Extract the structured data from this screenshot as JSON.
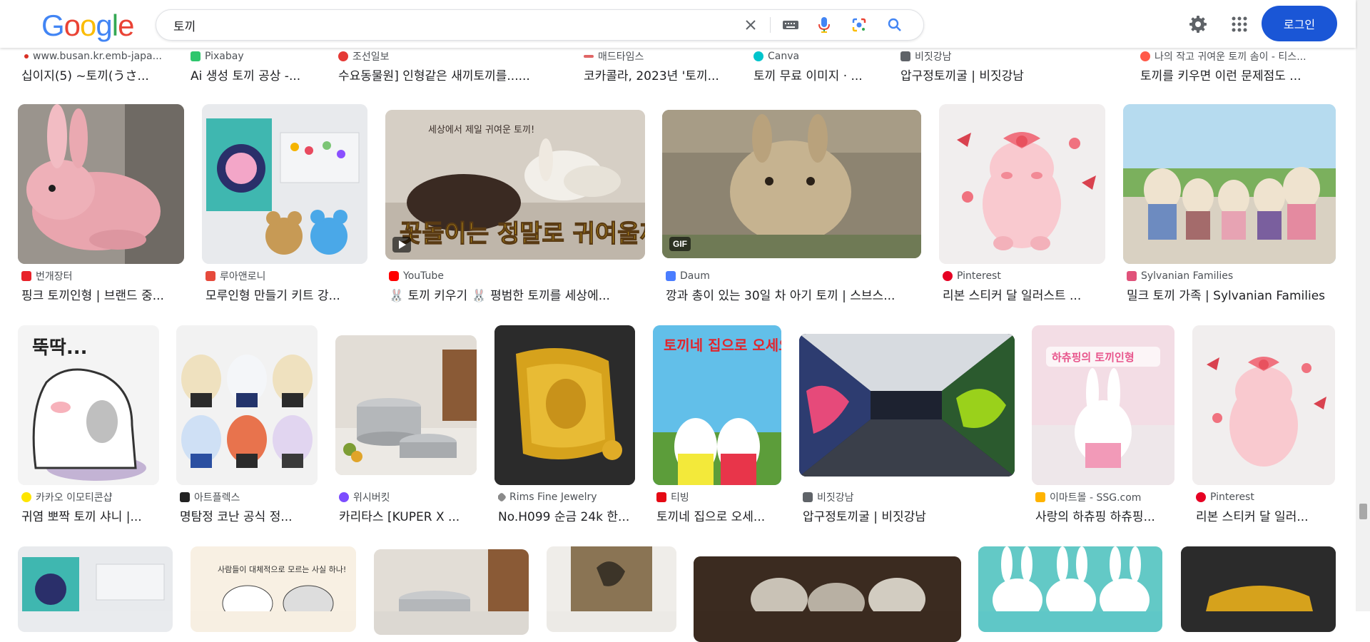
{
  "header": {
    "logo_letters": [
      "G",
      "o",
      "o",
      "g",
      "l",
      "e"
    ],
    "logo_colors": [
      "#4285f4",
      "#ea4335",
      "#fbbc05",
      "#4285f4",
      "#34a853",
      "#ea4335"
    ],
    "search_value": "토끼",
    "login_label": "로그인",
    "icons": {
      "clear": "close-icon",
      "keyboard": "keyboard-icon",
      "voice": "microphone-icon",
      "lens": "lens-icon",
      "search": "search-icon",
      "settings": "gear-icon",
      "apps": "apps-grid-icon"
    },
    "accent": "#1a56d6"
  },
  "rows": [
    {
      "items": [
        {
          "source": "www.busan.kr.emb-japa...",
          "title": "십이지(5) ~토끼(うさ...",
          "fav_color": "#d93025"
        },
        {
          "source": "Pixabay",
          "title": "Ai 생성 토끼 공상 -...",
          "fav_color": "#2ec66d"
        },
        {
          "source": "조선일보",
          "title": "수요동물원] 인형같은 새끼토끼를......",
          "fav_color": "#e53935"
        },
        {
          "source": "매드타임스",
          "title": "코카콜라, 2023년 '토끼...",
          "fav_color": "#e06666"
        },
        {
          "source": "Canva",
          "title": "토끼 무료 이미지 · ...",
          "fav_color": "#00c4cc"
        },
        {
          "source": "비짓강남",
          "title": "압구정토끼굴 | 비짓강남",
          "fav_color": "#5f6368"
        },
        {
          "source": "나의 작고 귀여운 토끼 솜이 - 티스...",
          "title": "토끼를 키우면 이런 문제점도 ...",
          "fav_color": "#ff5a4a"
        }
      ]
    },
    {
      "items": [
        {
          "source": "번개장터",
          "title": "핑크 토끼인형 | 브랜드 중...",
          "fav_color": "#e8222a"
        },
        {
          "source": "루아앤로니",
          "title": "모루인형 만들기 키트 강...",
          "fav_color": "#e64a3c"
        },
        {
          "source": "YouTube",
          "title": "🐰 토끼 키우기 🐰 평범한 토끼를 세상에...",
          "fav_color": "#ff0000",
          "badge": "play"
        },
        {
          "source": "Daum",
          "title": "깡과 총이 있는 30일 차 아기 토끼 | 스브스...",
          "fav_color": "#4a7dff",
          "badge": "GIF"
        },
        {
          "source": "Pinterest",
          "title": "리본 스티커 달 일러스트 ...",
          "fav_color": "#e60023"
        },
        {
          "source": "Sylvanian Families",
          "title": "밀크 토끼 가족 | Sylvanian Families",
          "fav_color": "#e0527a"
        }
      ]
    },
    {
      "items": [
        {
          "source": "카카오 이모티콘샵",
          "title": "귀염 뽀짝 토끼 샤니 |...",
          "fav_color": "#fee500"
        },
        {
          "source": "아트플렉스",
          "title": "명탐정 코난 공식 정...",
          "fav_color": "#222222"
        },
        {
          "source": "위시버킷",
          "title": "카리타스 [KUPER X ...",
          "fav_color": "#7c4dff"
        },
        {
          "source": "Rims Fine Jewelry",
          "title": "No.H099 순금 24k 한...",
          "fav_color": "#8a8a8a"
        },
        {
          "source": "티빙",
          "title": "토끼네 집으로 오세...",
          "fav_color": "#e50914"
        },
        {
          "source": "비짓강남",
          "title": "압구정토끼굴 | 비짓강남",
          "fav_color": "#5f6368"
        },
        {
          "source": "이마트몰 - SSG.com",
          "title": "사랑의 하츄핑 하츄핑...",
          "fav_color": "#ffb300"
        },
        {
          "source": "Pinterest",
          "title": "리본 스티커 달 일러...",
          "fav_color": "#e60023"
        }
      ]
    }
  ],
  "image_captions": {
    "youtube_overlay": "꽃돌이는 정말로 귀여울까?",
    "youtube_note": "세상에서 제일 귀여운 토끼!",
    "emoticon_text": "뚝딱...",
    "tving_poster": "토끼네 집으로 오세요4",
    "hachuping_banner": "하츄핑의 토끼인형",
    "bottom_poster": "사람들이 대체적으로 모르는 사실 하나!"
  }
}
